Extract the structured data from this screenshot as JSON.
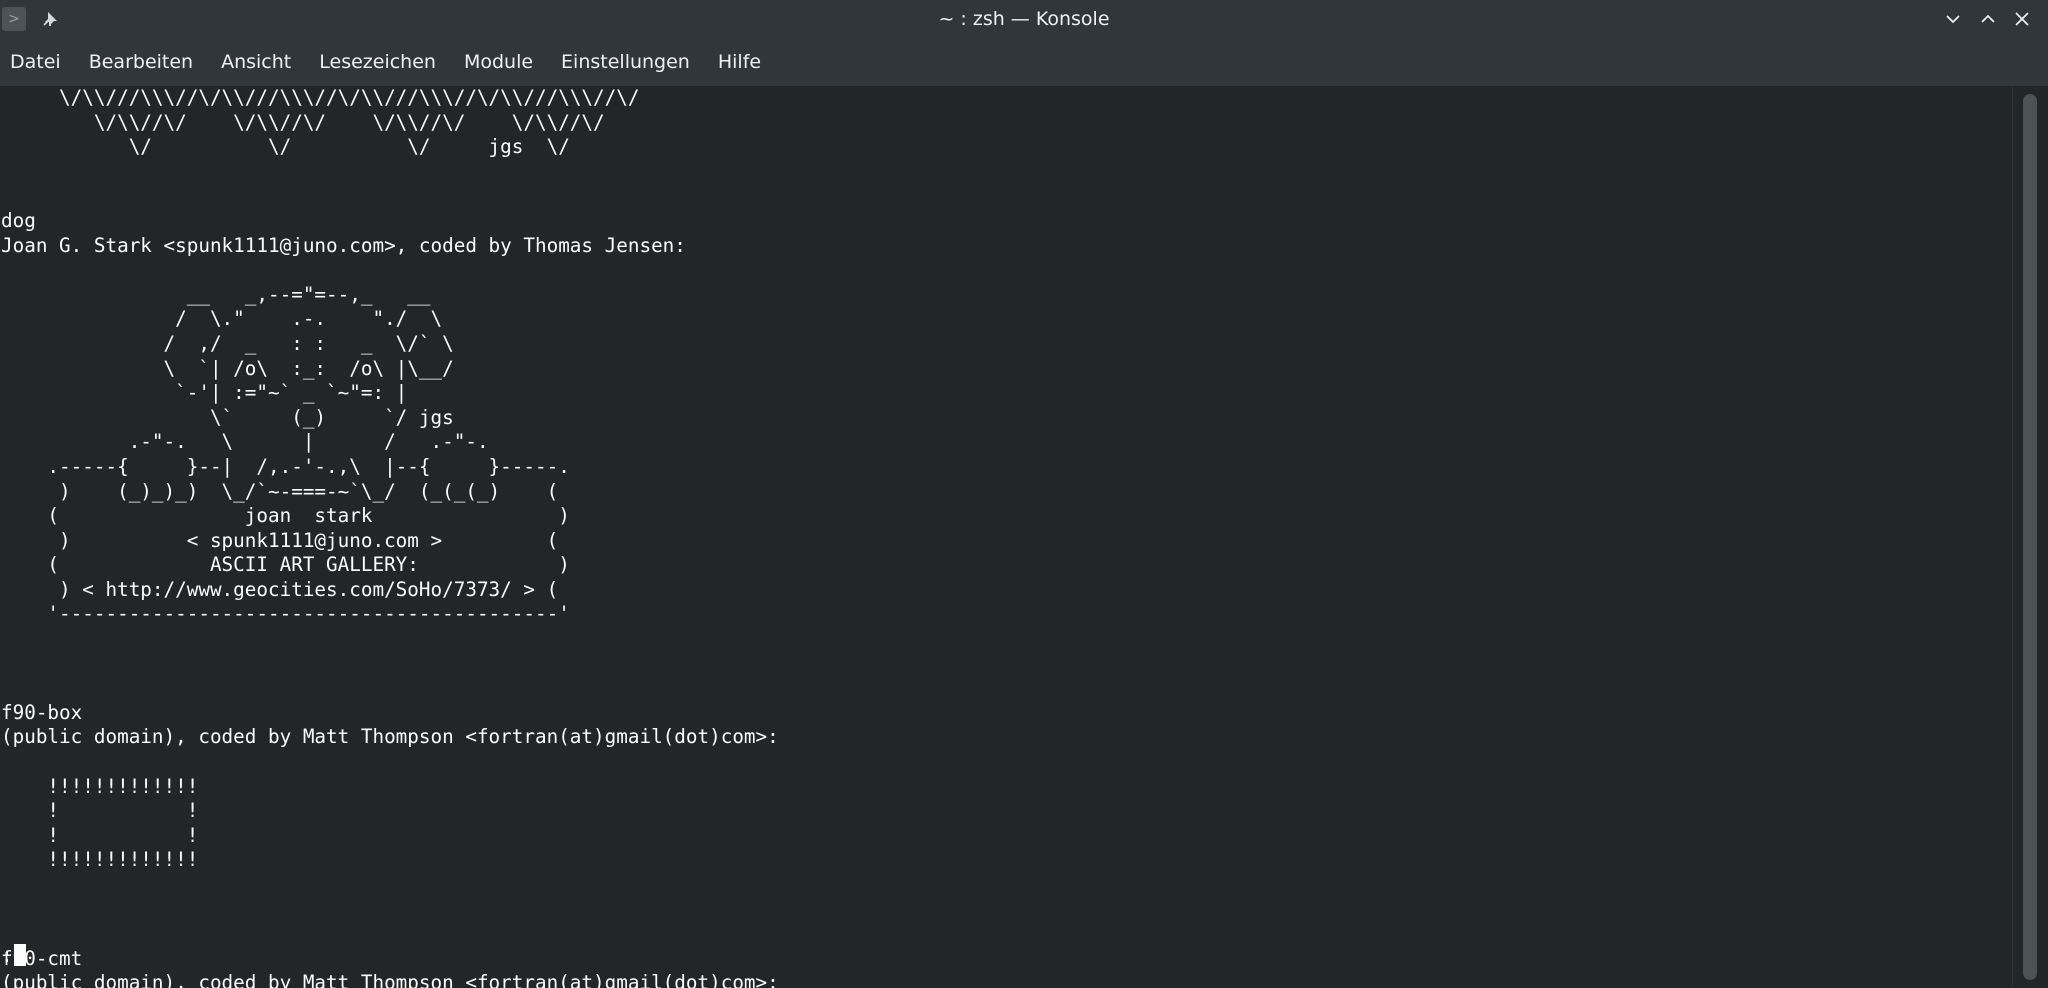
{
  "window": {
    "title": "~ : zsh — Konsole",
    "app_icon": "terminal-app-icon",
    "pin_icon": "pin-icon",
    "controls": [
      "minimize-icon",
      "maximize-icon",
      "close-icon"
    ]
  },
  "menu": {
    "items": [
      "Datei",
      "Bearbeiten",
      "Ansicht",
      "Lesezeichen",
      "Module",
      "Einstellungen",
      "Hilfe"
    ]
  },
  "terminal": {
    "output": "     \\/\\\\///\\\\\\//\\/\\\\///\\\\\\//\\/\\\\///\\\\\\//\\/\\\\///\\\\\\//\\/\n        \\/\\\\//\\/    \\/\\\\//\\/    \\/\\\\//\\/    \\/\\\\//\\/\n           \\/          \\/          \\/     jgs  \\/\n\n\ndog\nJoan G. Stark <spunk1111@juno.com>, coded by Thomas Jensen:\n\n                __   _,--=\"=--,_   __\n               /  \\.\"    .-.    \"./  \\\n              /  ,/  _   : :   _  \\/` \\\n              \\  `| /o\\  :_:  /o\\ |\\__/\n               `-'| :=\"~` _ `~\"=: |\n                  \\`     (_)     `/ jgs\n           .-\"-.   \\      |      /   .-\"-.\n    .-----{     }--|  /,.-'-.,\\  |--{     }-----.\n     )    (_)_)_)  \\_/`~-===-~`\\_/  (_(_(_)    (\n    (                joan  stark                )\n     )          < spunk1111@juno.com >         (\n    (             ASCII ART GALLERY:            )\n     ) < http://www.geocities.com/SoHo/7373/ > (\n    '-------------------------------------------'\n\n\n\nf90-box\n(public domain), coded by Matt Thompson <fortran(at)gmail(dot)com>:\n\n    !!!!!!!!!!!!!\n    !           !\n    !           !\n    !!!!!!!!!!!!!\n\n\n\nf90-cmt\n(public domain), coded by Matt Thompson <fortran(at)gmail(dot)com>:",
    "prompt": ":"
  },
  "colors": {
    "terminal_bg": "#232627",
    "terminal_fg": "#fcfcfc",
    "chrome_bg": "#31363b"
  }
}
